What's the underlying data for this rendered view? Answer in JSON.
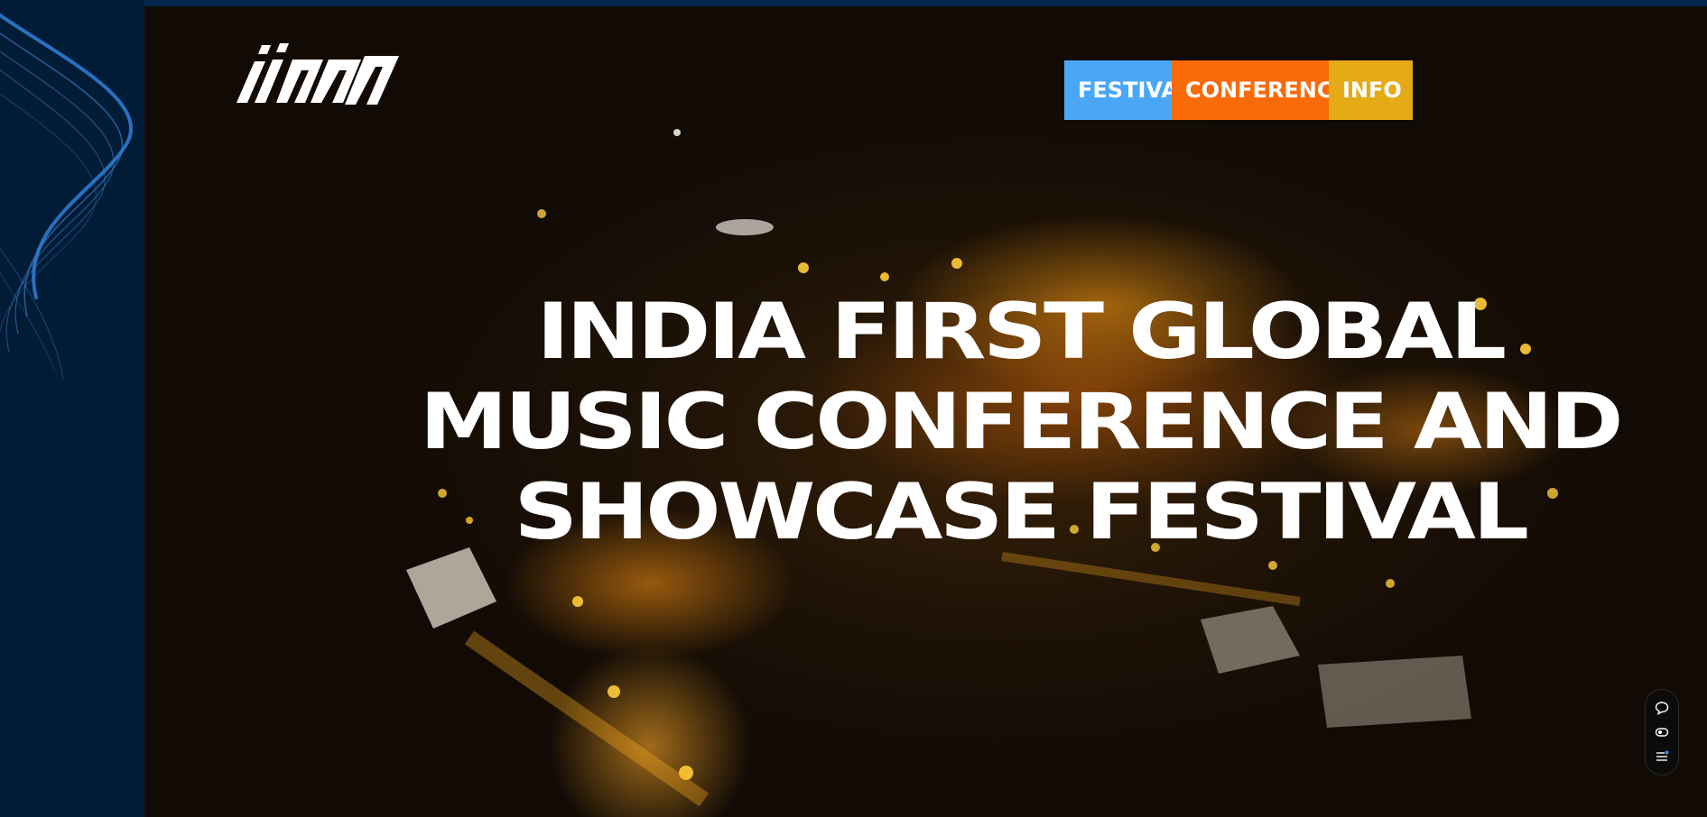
{
  "brand": {
    "logo_text": "iimw",
    "logo_icon": "iimw-wordmark-logo"
  },
  "nav": {
    "items": [
      {
        "label": "FESTIVAL",
        "color": "#4aa7f7"
      },
      {
        "label": "CONFERENCE",
        "color": "#f96a08"
      },
      {
        "label": "INFO",
        "color": "#e4ab16"
      }
    ]
  },
  "hero": {
    "headline_lines": [
      "INDIA FIRST GLOBAL",
      "MUSIC CONFERENCE AND",
      "SHOWCASE FESTIVAL"
    ],
    "background_description_icon": "aerial-night-festival-video"
  },
  "widget": {
    "buttons": [
      {
        "icon": "chat-bubble-icon"
      },
      {
        "icon": "toggle-eye-icon"
      },
      {
        "icon": "list-menu-icon"
      }
    ]
  },
  "colors": {
    "page_background": "#02203f",
    "side_panel": "#021c37",
    "accent_blue": "#4aa7f7",
    "accent_orange": "#f96a08",
    "accent_yellow": "#e4ab16"
  }
}
